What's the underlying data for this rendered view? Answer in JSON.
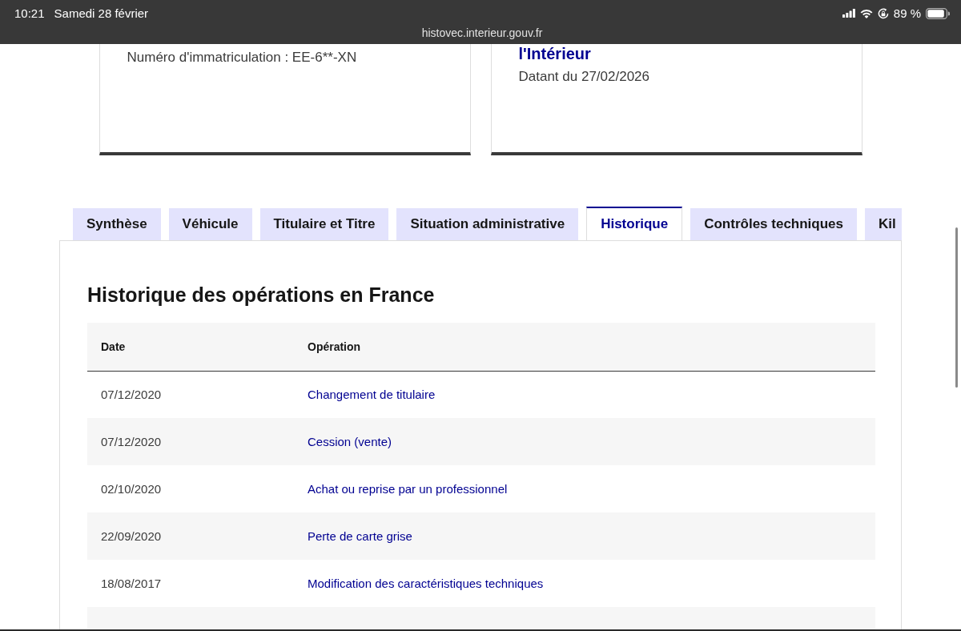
{
  "status_bar": {
    "time": "10:21",
    "date": "Samedi 28 février",
    "battery": "89 %",
    "url": "histovec.interieur.gouv.fr"
  },
  "cards": [
    {
      "lines": [
        {
          "kind": "text",
          "text": "Numéro d'immatriculation : EE-6**-XN"
        }
      ]
    },
    {
      "lines": [
        {
          "kind": "title",
          "text": "l'Intérieur"
        },
        {
          "kind": "text",
          "text": "Datant du 27/02/2026"
        }
      ]
    }
  ],
  "tabs": [
    {
      "label": "Synthèse",
      "selected": false
    },
    {
      "label": "Véhicule",
      "selected": false
    },
    {
      "label": "Titulaire et Titre",
      "selected": false
    },
    {
      "label": "Situation administrative",
      "selected": false
    },
    {
      "label": "Historique",
      "selected": true
    },
    {
      "label": "Contrôles techniques",
      "selected": false
    },
    {
      "label": "Kil",
      "selected": false
    }
  ],
  "history": {
    "title": "Historique des opérations en France",
    "columns": [
      "Date",
      "Opération"
    ],
    "rows": [
      {
        "date": "07/12/2020",
        "operation": "Changement de titulaire"
      },
      {
        "date": "07/12/2020",
        "operation": "Cession (vente)"
      },
      {
        "date": "02/10/2020",
        "operation": "Achat ou reprise par un professionnel"
      },
      {
        "date": "22/09/2020",
        "operation": "Perte de carte grise"
      },
      {
        "date": "18/08/2017",
        "operation": "Modification des caractéristiques techniques"
      }
    ]
  }
}
